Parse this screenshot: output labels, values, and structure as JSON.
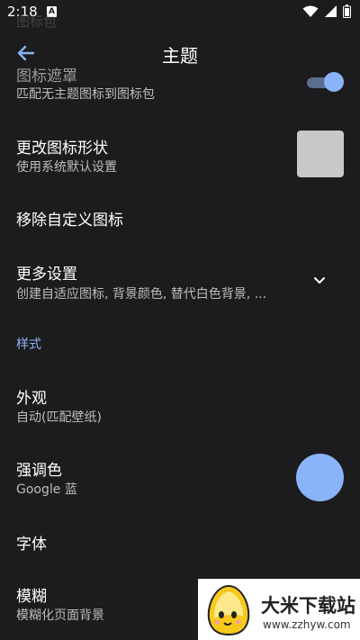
{
  "status": {
    "time": "2:18",
    "notif_letter": "A"
  },
  "ghost_text": "图标包",
  "app_bar": {
    "title": "主题"
  },
  "rows": [
    {
      "title": "图标遮罩",
      "subtitle": "匹配无主题图标到图标包"
    },
    {
      "title": "更改图标形状",
      "subtitle": "使用系统默认设置"
    },
    {
      "title": "移除自定义图标"
    },
    {
      "title": "更多设置",
      "subtitle": "创建自适应图标, 背景颜色, 替代白色背景, ..."
    },
    {
      "title": "外观",
      "subtitle": "自动(匹配壁纸)"
    },
    {
      "title": "强调色",
      "subtitle": "Google 蓝"
    },
    {
      "title": "字体"
    },
    {
      "title": "模糊",
      "subtitle": "模糊化页面背景"
    }
  ],
  "section_style": "样式",
  "toggle": {
    "on": true
  },
  "accent_color": "#8ab4f8",
  "watermark": {
    "brand": "大米下载站",
    "url": "www.zzhyw.com"
  }
}
